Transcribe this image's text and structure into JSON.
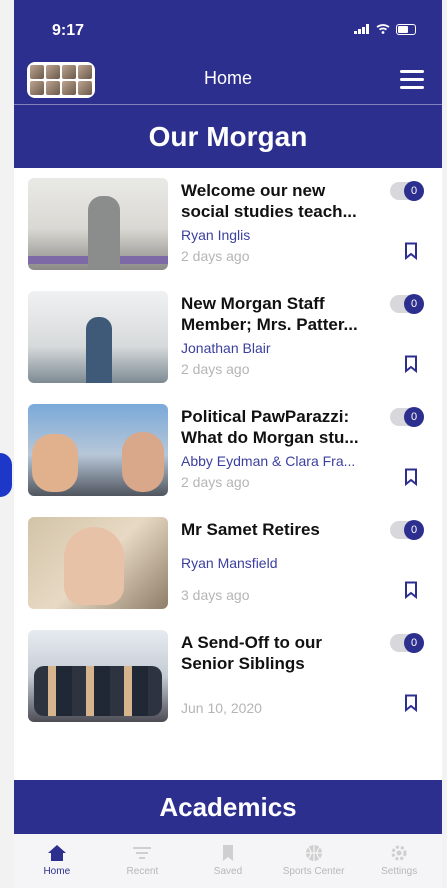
{
  "status_bar": {
    "time": "9:17"
  },
  "header": {
    "title": "Home"
  },
  "section": {
    "title": "Our Morgan"
  },
  "articles": [
    {
      "title_line1": "Welcome our new",
      "title_line2": "social studies teach...",
      "author": "Ryan Inglis",
      "date": "2 days ago",
      "badge": "0"
    },
    {
      "title_line1": "New Morgan Staff",
      "title_line2": "Member; Mrs. Patter...",
      "author": "Jonathan Blair",
      "date": "2 days ago",
      "badge": "0"
    },
    {
      "title_line1": "Political PawParazzi:",
      "title_line2": "What do Morgan stu...",
      "author": "Abby Eydman & Clara Fra...",
      "date": "2 days ago",
      "badge": "0"
    },
    {
      "title_line1": "Mr Samet Retires",
      "title_line2": "",
      "author": "Ryan Mansfield",
      "date": "3 days ago",
      "badge": "0"
    },
    {
      "title_line1": "A Send-Off to our",
      "title_line2": "Senior Siblings",
      "author": "",
      "date": "Jun 10, 2020",
      "badge": "0"
    }
  ],
  "next_section": {
    "title": "Academics"
  },
  "tabs": [
    {
      "label": "Home",
      "icon": "home-icon"
    },
    {
      "label": "Recent",
      "icon": "filter-lines-icon"
    },
    {
      "label": "Saved",
      "icon": "bookmark-icon"
    },
    {
      "label": "Sports Center",
      "icon": "ball-icon"
    },
    {
      "label": "Settings",
      "icon": "gear-icon"
    }
  ],
  "colors": {
    "brand": "#2d2f8f",
    "author": "#3b3f9f",
    "date": "#b5b5b5"
  }
}
